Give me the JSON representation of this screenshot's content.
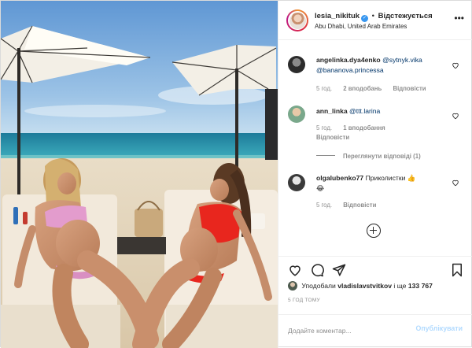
{
  "post": {
    "username": "lesia_nikituk",
    "follow_separator": "•",
    "follow_label": "Відстежується",
    "location": "Abu Dhabi, United Arab Emirates",
    "more_icon": "more-horizontal-icon"
  },
  "comments": [
    {
      "username": "angelinka.dya4enko",
      "mentions": [
        "@sytnyk.vika",
        "@bananova.princessa"
      ],
      "time": "5 год.",
      "likes": "2 вподобань",
      "reply": "Відповісти"
    },
    {
      "username": "ann_linka",
      "mentions": [
        "@ttt.larina"
      ],
      "time": "5 год.",
      "likes": "1 вподобання",
      "reply": "Відповісти",
      "view_replies": "Переглянути відповіді (1)"
    },
    {
      "username": "olgalubenko77",
      "text": "Приколистки",
      "emoji": [
        "👍",
        "😂"
      ],
      "time": "5 год.",
      "reply": "Відповісти"
    }
  ],
  "likes": {
    "prefix": "Уподобали",
    "user": "vladislavstvitkov",
    "middle": "і ще",
    "count": "133 767"
  },
  "posted_ago": "5 ГОД ТОМУ",
  "add_comment": {
    "placeholder": "Додайте коментар...",
    "post_label": "Опублікувати"
  },
  "colors": {
    "link": "#003569",
    "muted": "#8e8e8e",
    "verified": "#3897f0",
    "post_disabled": "#b3dbff"
  }
}
